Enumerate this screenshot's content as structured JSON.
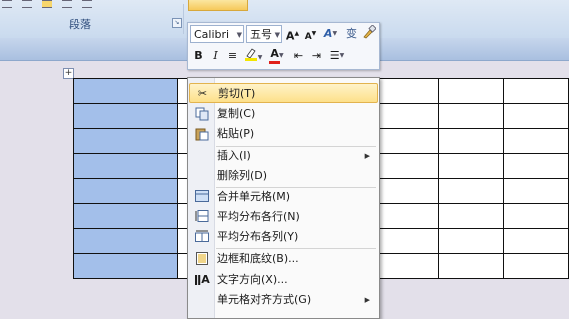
{
  "ribbon": {
    "group_label": "段落"
  },
  "mini_toolbar": {
    "font_name": "Calibri",
    "font_size": "五号",
    "buttons": {
      "grow_font": "A",
      "shrink_font": "A",
      "styles": "A",
      "phonetic": "变",
      "bold": "B",
      "italic": "I",
      "font_color": "A"
    }
  },
  "context_menu": {
    "items": [
      {
        "label": "剪切(T)",
        "icon": "scissors-icon"
      },
      {
        "label": "复制(C)",
        "icon": "copy-icon"
      },
      {
        "label": "粘贴(P)",
        "icon": "paste-icon"
      },
      {
        "label": "插入(I)",
        "icon": "",
        "submenu": true
      },
      {
        "label": "删除列(D)",
        "icon": ""
      },
      {
        "label": "合并单元格(M)",
        "icon": "merge-cells-icon"
      },
      {
        "label": "平均分布各行(N)",
        "icon": "distribute-rows-icon"
      },
      {
        "label": "平均分布各列(Y)",
        "icon": "distribute-columns-icon"
      },
      {
        "label": "边框和底纹(B)...",
        "icon": "borders-icon"
      },
      {
        "label": "文字方向(X)...",
        "icon": "text-direction-icon"
      },
      {
        "label": "单元格对齐方式(G)",
        "icon": "",
        "submenu": true
      }
    ]
  }
}
